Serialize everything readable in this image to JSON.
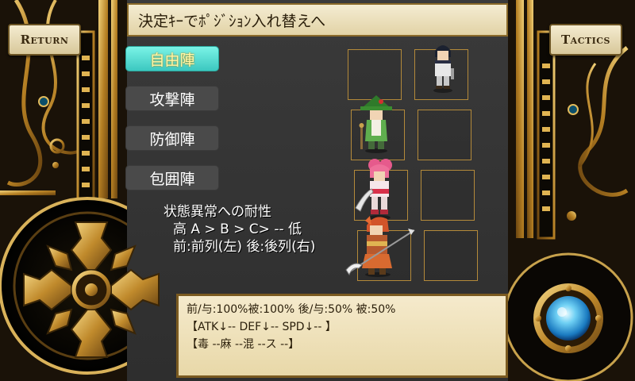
{
  "header": {
    "title": "決定ｷｰでﾎﾟｼﾞｼｮﾝ入れ替えへ",
    "return_label": "Return",
    "tactics_label": "Tactics"
  },
  "formations": [
    {
      "label": "自由陣",
      "selected": true
    },
    {
      "label": "攻撃陣",
      "selected": false
    },
    {
      "label": "防御陣",
      "selected": false
    },
    {
      "label": "包囲陣",
      "selected": false
    }
  ],
  "party": [
    {
      "name": "black-haired-swordsman-sprite",
      "row": "back"
    },
    {
      "name": "green-hat-mage-sprite",
      "row": "front"
    },
    {
      "name": "pink-haired-fighter-sprite",
      "row": "front"
    },
    {
      "name": "red-haired-lancer-sprite",
      "row": "front"
    }
  ],
  "resist": {
    "title": "状態異常への耐性",
    "scale": "高 A > B > C> -- 低",
    "legend": "前:前列(左) 後:後列(右)"
  },
  "info": {
    "line1": "前/与:100%被:100%  後/与:50% 被:50%",
    "line2": "【ATK↓-- DEF↓-- SPD↓-- 】",
    "line3": "【毒 --麻 --混 --ス --】"
  },
  "colors": {
    "gold": "#c89a3a",
    "selected_formation": "#4fd8cf",
    "gem": "#3fb0e8"
  }
}
